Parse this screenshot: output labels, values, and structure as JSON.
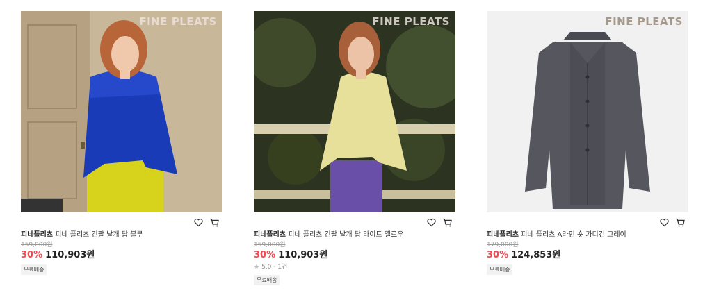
{
  "products": [
    {
      "brand_logo": "FINE PLEATS",
      "brand": "피네플리츠",
      "name": "피네 플리츠 긴팔 날개 탑 블루",
      "original_price": "159,000원",
      "discount": "30%",
      "price": "110,903원",
      "tag": "무료배송"
    },
    {
      "brand_logo": "FINE PLEATS",
      "brand": "피네플리츠",
      "name": "피네 플리츠 긴팔 날개 탑 라이트 옐로우",
      "original_price": "159,000원",
      "discount": "30%",
      "price": "110,903원",
      "rating": "5.0",
      "review_count": "1건",
      "tag": "무료배송"
    },
    {
      "brand_logo": "FINE PLEATS",
      "brand": "피네플리츠",
      "name": "피네 플리츠 A라인 숏 가디건 그레이",
      "original_price": "179,000원",
      "discount": "30%",
      "price": "124,853원",
      "tag": "무료배송"
    }
  ],
  "icons": {
    "wishlist": "heart-icon",
    "cart": "cart-icon",
    "rating": "star-icon"
  },
  "colors": {
    "discount": "#f5474f",
    "price": "#222222",
    "original_price": "#999999"
  }
}
